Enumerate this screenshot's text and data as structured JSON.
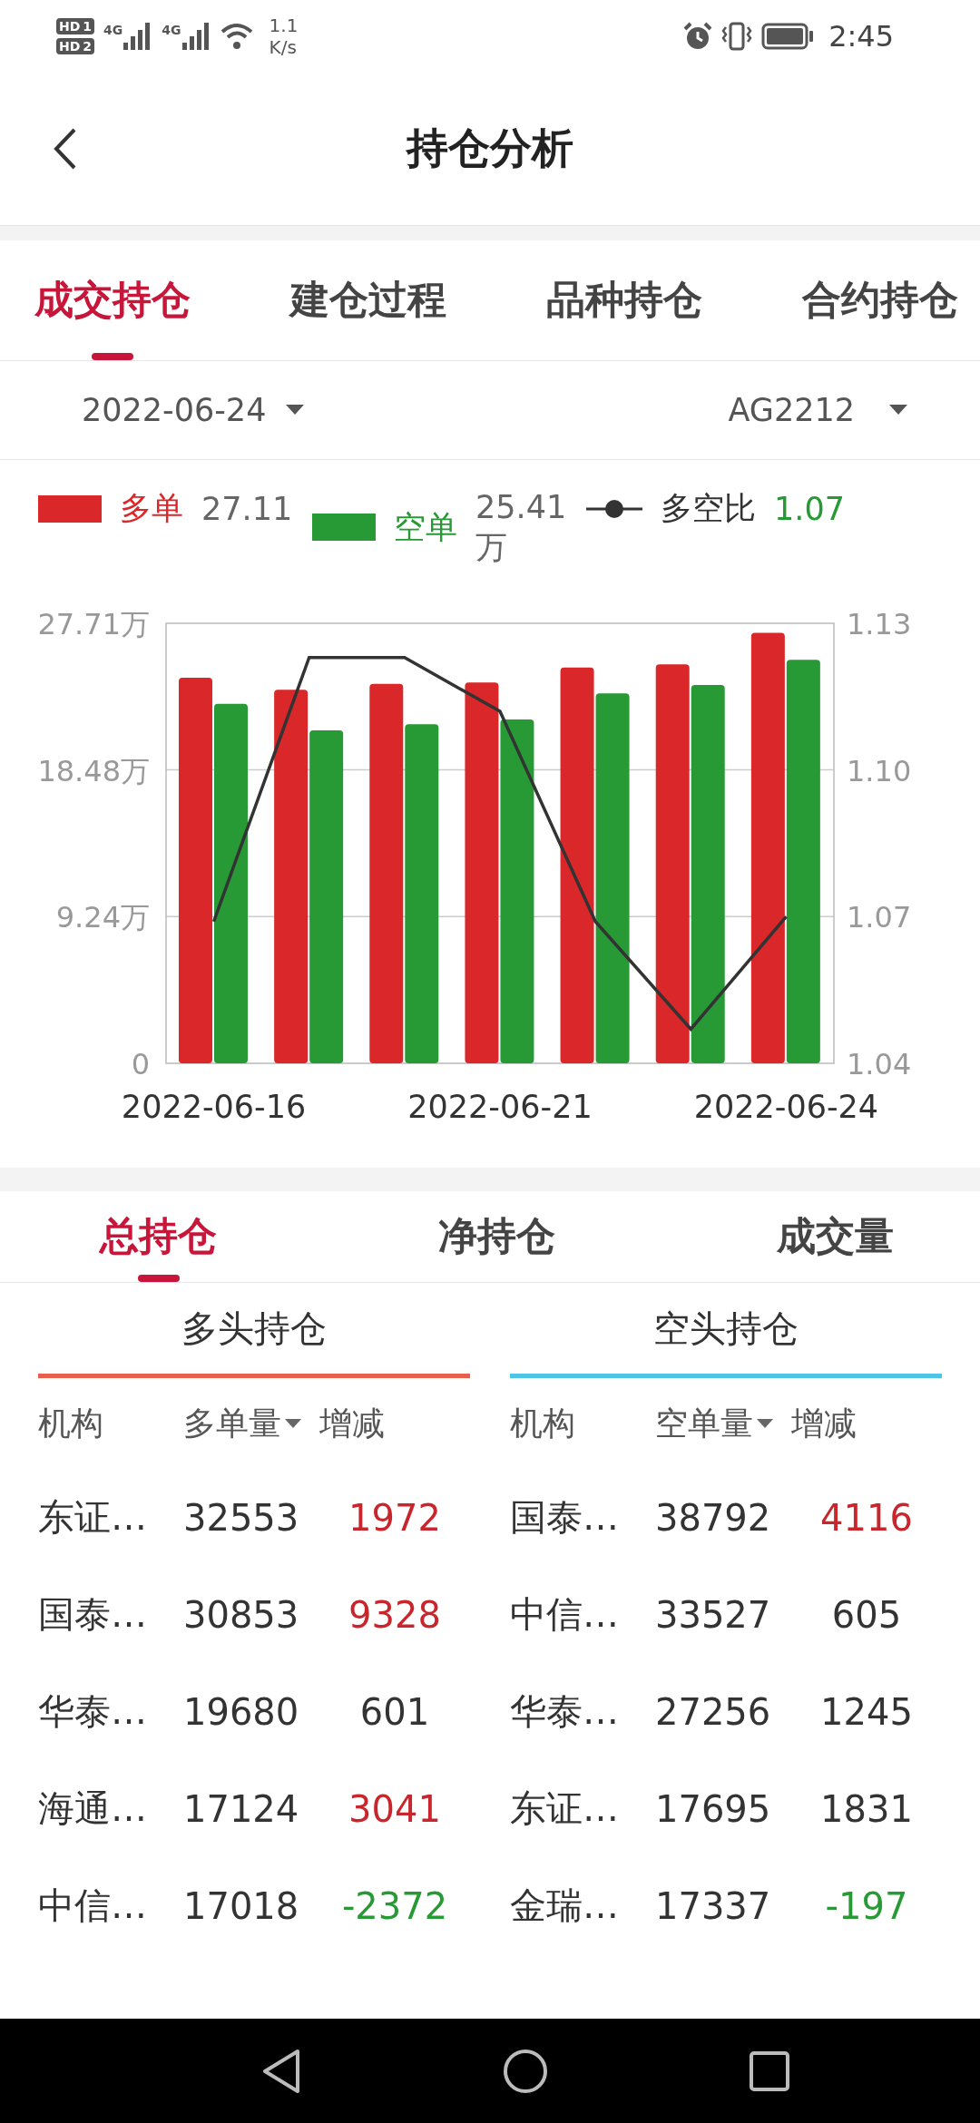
{
  "status_bar": {
    "sims": [
      {
        "label": "HD",
        "slot": "1"
      },
      {
        "label": "HD",
        "slot": "2"
      }
    ],
    "networks": [
      "4G",
      "4G"
    ],
    "speed_value": "1.1",
    "speed_unit": "K/s",
    "time": "2:45"
  },
  "header": {
    "title": "持仓分析"
  },
  "tabs": [
    {
      "label": "成交持仓",
      "selected": true
    },
    {
      "label": "建仓过程",
      "selected": false
    },
    {
      "label": "品种持仓",
      "selected": false
    },
    {
      "label": "合约持仓",
      "selected": false
    }
  ],
  "filters": {
    "date": "2022-06-24",
    "contract": "AG2212"
  },
  "legend": [
    {
      "kind": "bar",
      "value": "27.11"
    },
    {
      "kind": "bar",
      "value": "25.41万"
    },
    {
      "kind": "line",
      "value": "1.07"
    }
  ],
  "chart": {
    "chart_data": {
      "type": "bar",
      "categories": [
        "2022-06-16",
        null,
        null,
        "2022-06-21",
        null,
        null,
        "2022-06-24"
      ],
      "ylim": [
        0,
        27.71
      ],
      "yticks": [
        {
          "value": 0,
          "label": "0"
        },
        {
          "value": 9.24,
          "label": "9.24万"
        },
        {
          "value": 18.48,
          "label": "18.48万"
        },
        {
          "value": 27.71,
          "label": "27.71万"
        }
      ],
      "y2lim": [
        1.04,
        1.13
      ],
      "y2ticks": [
        {
          "value": 1.04,
          "label": "1.04"
        },
        {
          "value": 1.07,
          "label": "1.07"
        },
        {
          "value": 1.1,
          "label": "1.10"
        },
        {
          "value": 1.13,
          "label": "1.13"
        }
      ],
      "series": [
        {
          "name": "多单",
          "color": "#d9272a",
          "values": [
            24.28,
            23.52,
            23.9,
            23.98,
            24.93,
            25.12,
            27.11
          ]
        },
        {
          "name": "空单",
          "color": "#279a35",
          "values": [
            22.64,
            20.97,
            21.35,
            21.65,
            23.29,
            23.82,
            25.41
          ]
        },
        {
          "name": "多空比",
          "color": "#333333",
          "type": "line",
          "axis": "y2",
          "values": [
            1.069,
            1.123,
            1.123,
            1.112,
            1.069,
            1.047,
            1.07
          ]
        }
      ]
    }
  },
  "sub_tabs": [
    {
      "label": "总持仓",
      "selected": true
    },
    {
      "label": "净持仓",
      "selected": false
    },
    {
      "label": "成交量",
      "selected": false
    }
  ],
  "tables": [
    {
      "title": "多头持仓",
      "color": "#e8604c",
      "columns": [
        {
          "label": "机构",
          "sorted": false
        },
        {
          "label": "多单量",
          "sorted": true
        },
        {
          "label": "增减",
          "sorted": false
        }
      ],
      "rows": [
        {
          "institution": "东证…",
          "volume": "32553",
          "change": "1972",
          "color": "#c8262c"
        },
        {
          "institution": "国泰…",
          "volume": "30853",
          "change": "9328",
          "color": "#c8262c"
        },
        {
          "institution": "华泰…",
          "volume": "19680",
          "change": "601",
          "color": "#333333"
        },
        {
          "institution": "海通…",
          "volume": "17124",
          "change": "3041",
          "color": "#c8262c"
        },
        {
          "institution": "中信…",
          "volume": "17018",
          "change": "-2372",
          "color": "#279a35"
        }
      ]
    },
    {
      "title": "空头持仓",
      "color": "#4fc3e8",
      "columns": [
        {
          "label": "机构",
          "sorted": false
        },
        {
          "label": "空单量",
          "sorted": true
        },
        {
          "label": "增减",
          "sorted": false
        }
      ],
      "rows": [
        {
          "institution": "国泰…",
          "volume": "38792",
          "change": "4116",
          "color": "#c8262c"
        },
        {
          "institution": "中信…",
          "volume": "33527",
          "change": "605",
          "color": "#333333"
        },
        {
          "institution": "华泰…",
          "volume": "27256",
          "change": "1245",
          "color": "#333333"
        },
        {
          "institution": "东证…",
          "volume": "17695",
          "change": "1831",
          "color": "#333333"
        },
        {
          "institution": "金瑞…",
          "volume": "17337",
          "change": "-197",
          "color": "#279a35"
        }
      ]
    }
  ]
}
